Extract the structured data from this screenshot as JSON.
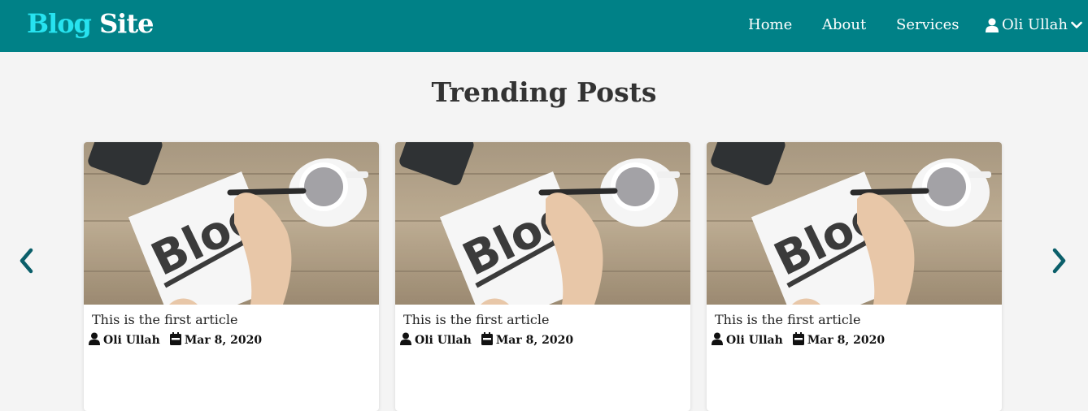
{
  "brand": {
    "part1": "Blog",
    "part2": "Site"
  },
  "nav": {
    "links": [
      {
        "label": "Home"
      },
      {
        "label": "About"
      },
      {
        "label": "Services"
      }
    ],
    "user": {
      "name": "Oli Ullah",
      "icon": "user-icon",
      "caret": "chevron-down-icon"
    }
  },
  "section": {
    "title": "Trending Posts"
  },
  "carousel": {
    "prev_icon": "chevron-left-icon",
    "next_icon": "chevron-right-icon",
    "cards": [
      {
        "title": "This is the first article",
        "author": "Oli Ullah",
        "date": "Mar 8, 2020"
      },
      {
        "title": "This is the first article",
        "author": "Oli Ullah",
        "date": "Mar 8, 2020"
      },
      {
        "title": "This is the first article",
        "author": "Oli Ullah",
        "date": "Mar 8, 2020"
      }
    ]
  },
  "colors": {
    "navbar": "#008187",
    "brand_accent": "#27e3f0",
    "arrow": "#0b5f6a",
    "page_bg": "#f4f4f4"
  }
}
